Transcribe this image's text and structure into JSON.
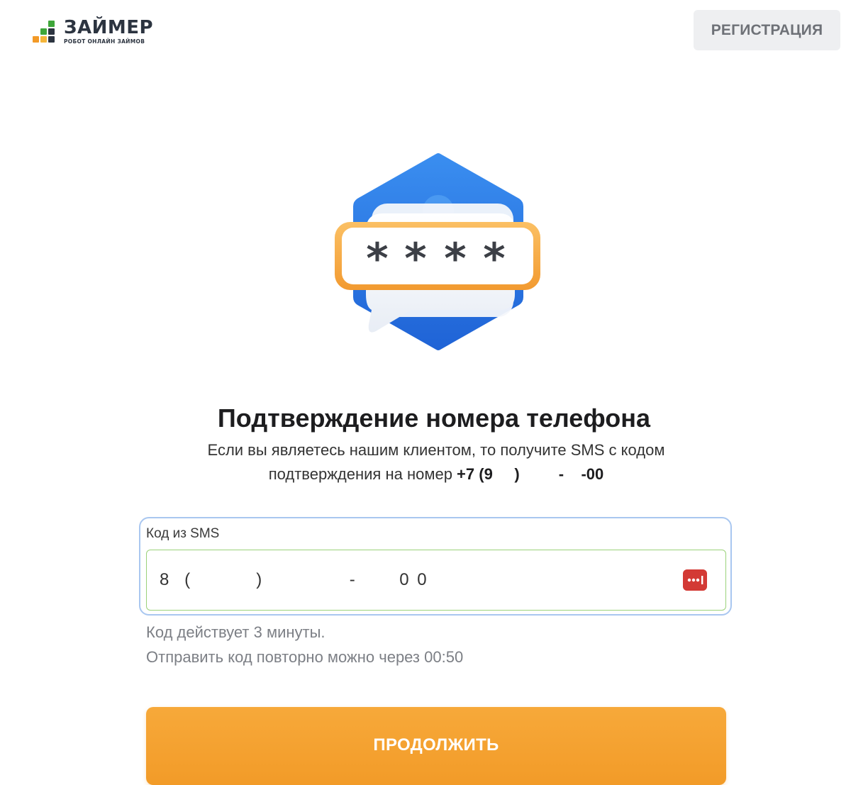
{
  "colors": {
    "brand_dark": "#2c3440",
    "brand_green": "#3ea63a",
    "brand_orange": "#f39a27",
    "button_orange": "#f29b28",
    "accent_blue": "#2f7de1",
    "field_border_focus": "#a9c7f0",
    "field_border_valid": "#9bd27a",
    "icon_red": "#d33a35"
  },
  "header": {
    "brand": "ЗАЙМЕР",
    "tagline": "РОБОТ ОНЛАЙН ЗАЙМОВ",
    "register_label": "РЕГИСТРАЦИЯ"
  },
  "illustration": {
    "icon": "sms-code-bubble-icon",
    "masked_code": "* * * *"
  },
  "main": {
    "title": "Подтверждение номера телефона",
    "subtitle_line1": "Если вы являетесь нашим клиентом, то получите SMS с кодом",
    "subtitle_line2_prefix": "подтверждения на номер ",
    "masked_phone": "+7 (9     )         -    -00"
  },
  "form": {
    "code_label": "Код из SMS",
    "code_value": "8  (         )            -      0 0",
    "password_icon": "password-dots-icon"
  },
  "hints": {
    "validity": "Код действует 3 минуты.",
    "resend": "Отправить код повторно можно через 00:50"
  },
  "actions": {
    "continue_label": "ПРОДОЛЖИТЬ"
  }
}
